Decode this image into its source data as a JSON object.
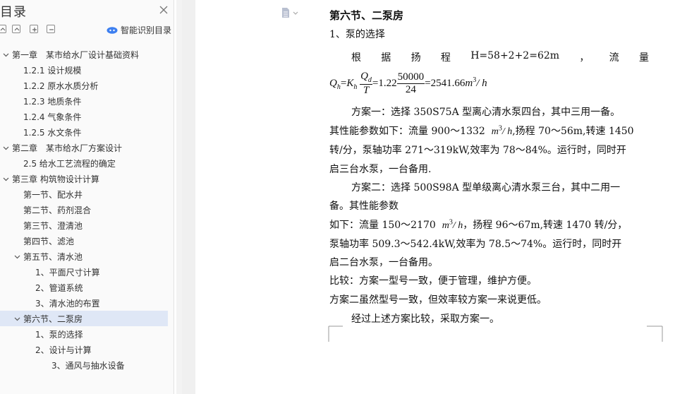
{
  "toc": {
    "title": "目录",
    "smart_toc_label": "智能识别目录",
    "items": [
      {
        "label": "第一章　某市给水厂设计基础资料",
        "level": 0,
        "expanded": true
      },
      {
        "label": "1.2.1 设计规模",
        "level": 1
      },
      {
        "label": "1.2.2 原水水质分析",
        "level": 1
      },
      {
        "label": "1.2.3 地质条件",
        "level": 1
      },
      {
        "label": "1.2.4 气象条件",
        "level": 1
      },
      {
        "label": "1.2.5 水文条件",
        "level": 1
      },
      {
        "label": "第二章　某市给水厂方案设计",
        "level": 0,
        "expanded": true
      },
      {
        "label": "2.5 给水工艺流程的确定",
        "level": 1
      },
      {
        "label": "第三章 构筑物设计计算",
        "level": 0,
        "expanded": true
      },
      {
        "label": "第一节、配水井",
        "level": 1
      },
      {
        "label": "第二节、药剂混合",
        "level": 1
      },
      {
        "label": "第三节、澄清池",
        "level": 1
      },
      {
        "label": "第四节、滤池",
        "level": 1
      },
      {
        "label": "第五节、清水池",
        "level": 1,
        "expanded": true
      },
      {
        "label": "1、平面尺寸计算",
        "level": 2
      },
      {
        "label": "2、管道系统",
        "level": 2
      },
      {
        "label": "3、清水池的布置",
        "level": 2
      },
      {
        "label": "第六节、二泵房",
        "level": 1,
        "expanded": true,
        "selected": true
      },
      {
        "label": "1、泵的选择",
        "level": 2
      },
      {
        "label": "2、设计与计算",
        "level": 2
      },
      {
        "label": "3、通风与抽水设备",
        "level": 3
      }
    ]
  },
  "document": {
    "heading": "第六节、二泵房",
    "subheading": "1、泵的选择",
    "line_head_parts": [
      "根",
      "据",
      "扬",
      "程",
      "H=58+2+2=62m",
      "，",
      "流",
      "量"
    ],
    "formula": {
      "q": "Q",
      "q_sub": "h",
      "eq1": "=",
      "k": "K",
      "k_sub": "h",
      "num1": "Q",
      "num1_sub": "d",
      "den1": "T",
      "eq2": "=1.22",
      "num2": "50000",
      "den2": "24",
      "result": "=2541.66",
      "unit": "m",
      "unit_sup": "3",
      "unit_rest": "/ h"
    },
    "plan1_lines": [
      "方案一：选择 350S75A 型离心清水泵四台，其中三用一备。",
      "其性能参数如下：流量 900～1332",
      "转/分，泵轴功率 271～319kW,效率为 78～84%。运行时，同时开",
      "启三台水泵，一台备用."
    ],
    "plan1_unit": "m",
    "plan1_unit_sup": "3",
    "plan1_unit_rest": "/ h",
    "plan1_line2_tail": ",扬程 70～56m,转速 1450",
    "plan2_lines": [
      "方案二：选择 500S98A 型单级离心清水泵三台，其中二用一",
      "备。其性能参数",
      "如下：流量 150～2170",
      "泵轴功率 509.3～542.4kW,效率为 78.5～74%。运行时，同时开",
      "启二台水泵，一台备用。"
    ],
    "plan2_unit": "m",
    "plan2_unit_sup": "3",
    "plan2_unit_rest": "/ h",
    "plan2_line3_tail": "，扬程 96～67m,转速 1470 转/分，",
    "compare_lines": [
      "比较：方案一型号一致，便于管理，维护方便。",
      "方案二虽然型号一致，但效率较方案一来说更低。",
      "经过上述方案比较，采取方案一。"
    ]
  }
}
